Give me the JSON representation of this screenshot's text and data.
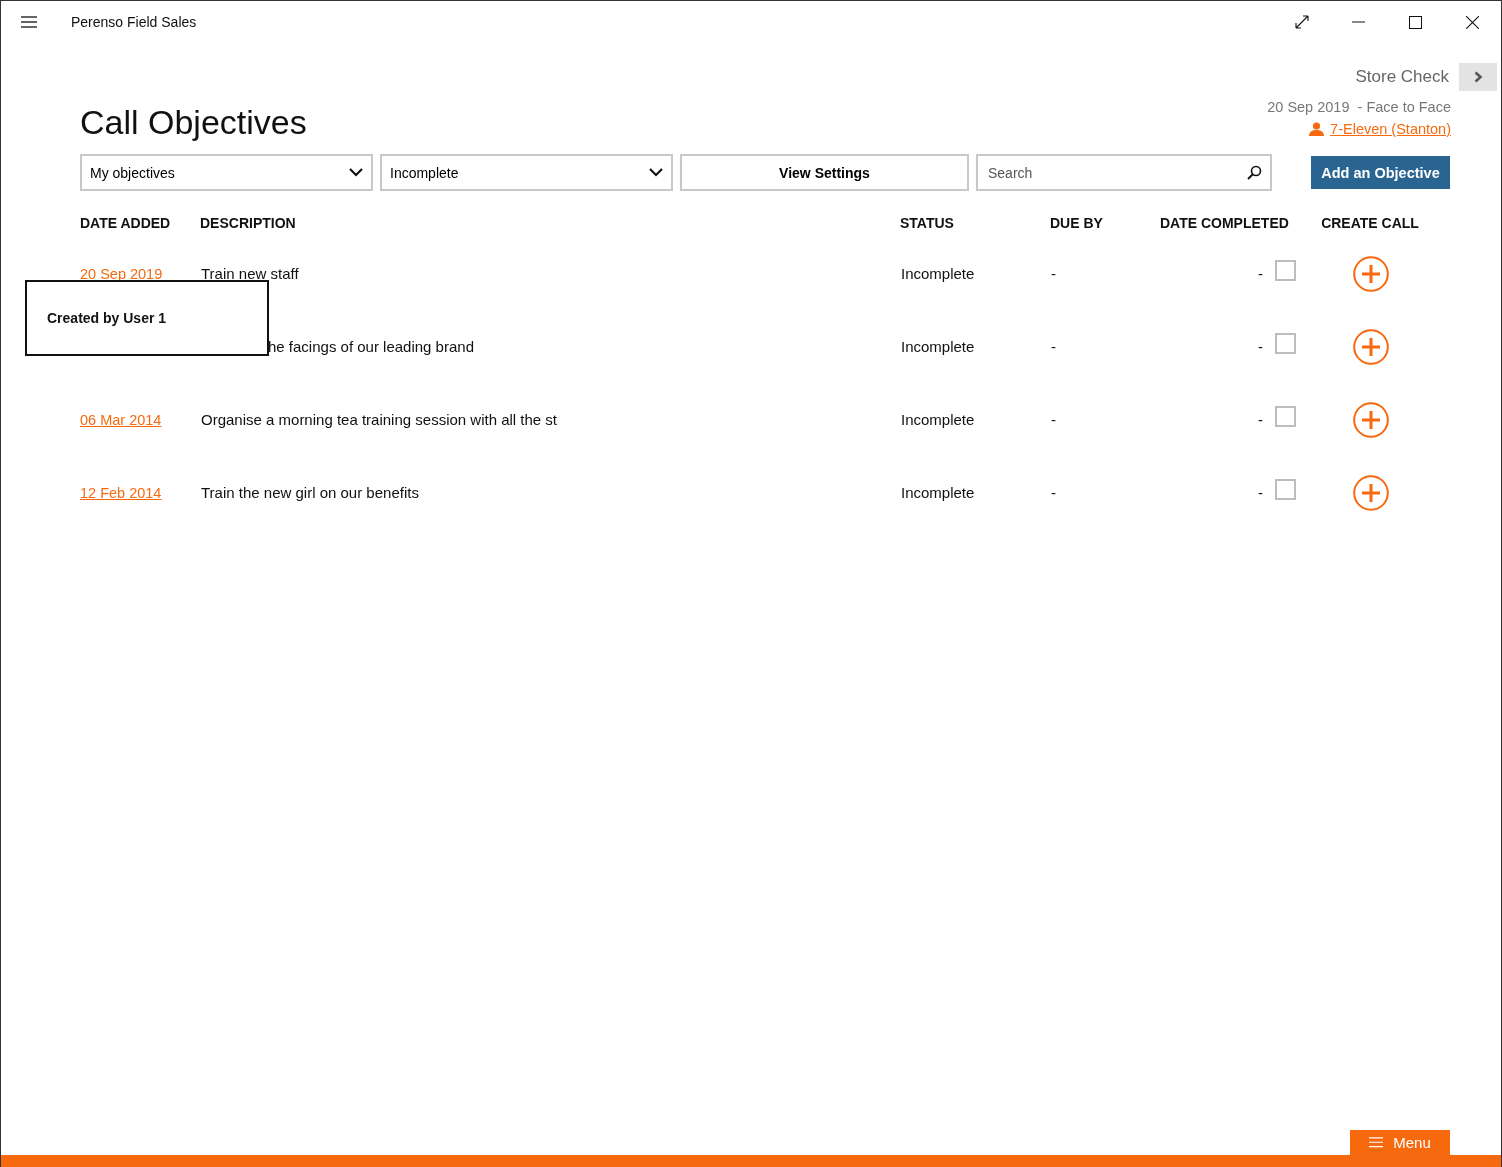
{
  "window": {
    "title": "Perenso Field Sales"
  },
  "next_step": {
    "label": "Store Check"
  },
  "page_title": "Call Objectives",
  "call_info": {
    "date": "20 Sep 2019",
    "type": "- Face to Face",
    "customer": "7-Eleven (Stanton)"
  },
  "filters": [
    {
      "kind": "dropdown",
      "value": "My objectives"
    },
    {
      "kind": "dropdown",
      "value": "Incomplete"
    },
    {
      "kind": "button",
      "value": "View Settings"
    }
  ],
  "search": {
    "placeholder": "Search"
  },
  "add_button": "Add an Objective",
  "table": {
    "columns": [
      "DATE ADDED",
      "DESCRIPTION",
      "STATUS",
      "DUE BY",
      "DATE COMPLETED",
      "CREATE CALL"
    ],
    "rows": [
      {
        "date": "20 Sep 2019",
        "description": "Train new staff",
        "covered": false,
        "status": "Incomplete",
        "due_by": "-",
        "date_completed": "-",
        "checked": false
      },
      {
        "description": "he facings of our leading brand",
        "covered": true,
        "status": "Incomplete",
        "due_by": "-",
        "date_completed": "-",
        "checked": false
      },
      {
        "date": "06 Mar 2014",
        "description": "Organise a morning tea training session with all the st",
        "covered": false,
        "status": "Incomplete",
        "due_by": "-",
        "date_completed": "-",
        "checked": false
      },
      {
        "date": "12 Feb 2014",
        "description": "Train the new girl on our benefits",
        "covered": false,
        "status": "Incomplete",
        "due_by": "-",
        "date_completed": "-",
        "checked": false
      }
    ]
  },
  "tooltip": {
    "text": "Created by User 1"
  },
  "menu_button": {
    "label": "Menu"
  }
}
